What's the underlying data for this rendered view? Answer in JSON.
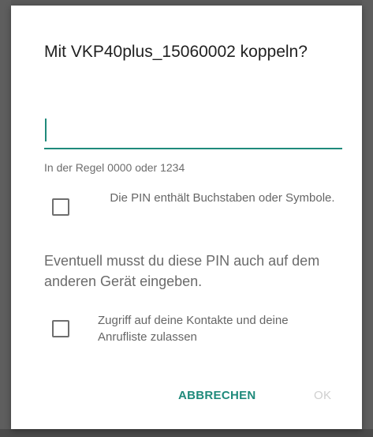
{
  "dialog": {
    "title": "Mit VKP40plus_15060002 koppeln?",
    "pin_input": {
      "value": "",
      "placeholder": ""
    },
    "hint": "In der Regel 0000 oder 1234",
    "pin_letters_checkbox": {
      "label": "Die PIN enthält Buchstaben oder Symbole.",
      "checked": false
    },
    "info": "Eventuell musst du diese PIN auch auf dem anderen Gerät eingeben.",
    "contacts_checkbox": {
      "label": "Zugriff auf deine Kontakte und deine Anrufliste zulassen",
      "checked": false
    },
    "buttons": {
      "cancel": "ABBRECHEN",
      "ok": "OK"
    }
  },
  "colors": {
    "accent": "#1f8a7b",
    "disabled": "#cfcfcf",
    "scrim": "#6b6b6b"
  }
}
